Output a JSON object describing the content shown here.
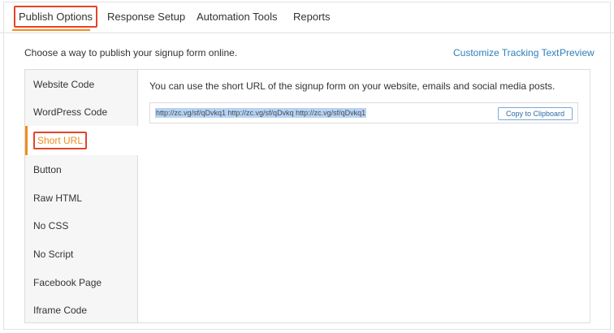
{
  "tabs": {
    "publish": "Publish Options",
    "response": "Response Setup",
    "automation": "Automation Tools",
    "reports": "Reports"
  },
  "header": {
    "intro": "Choose a way to publish your signup form online.",
    "customize_link": "Customize Tracking Text",
    "preview_link": "Preview"
  },
  "sidebar": {
    "items": [
      {
        "label": "Website Code"
      },
      {
        "label": "WordPress Code"
      },
      {
        "label": "Short URL"
      },
      {
        "label": "Button"
      },
      {
        "label": "Raw HTML"
      },
      {
        "label": "No CSS"
      },
      {
        "label": "No Script"
      },
      {
        "label": "Facebook Page"
      },
      {
        "label": "Iframe Code"
      }
    ],
    "active": "Short URL"
  },
  "main": {
    "description": "You can use the short URL of the signup form on your website, emails and social media posts.",
    "url_value": "http://zc.vg/sf/qDvkq1 http://zc.vg/sf/qDvkq http://zc.vg/sf/qDvkq1",
    "copy_label": "Copy to Clipboard"
  },
  "colors": {
    "accent": "#f28c1e",
    "highlight_box": "#e4442b",
    "link": "#2d7fb8"
  }
}
